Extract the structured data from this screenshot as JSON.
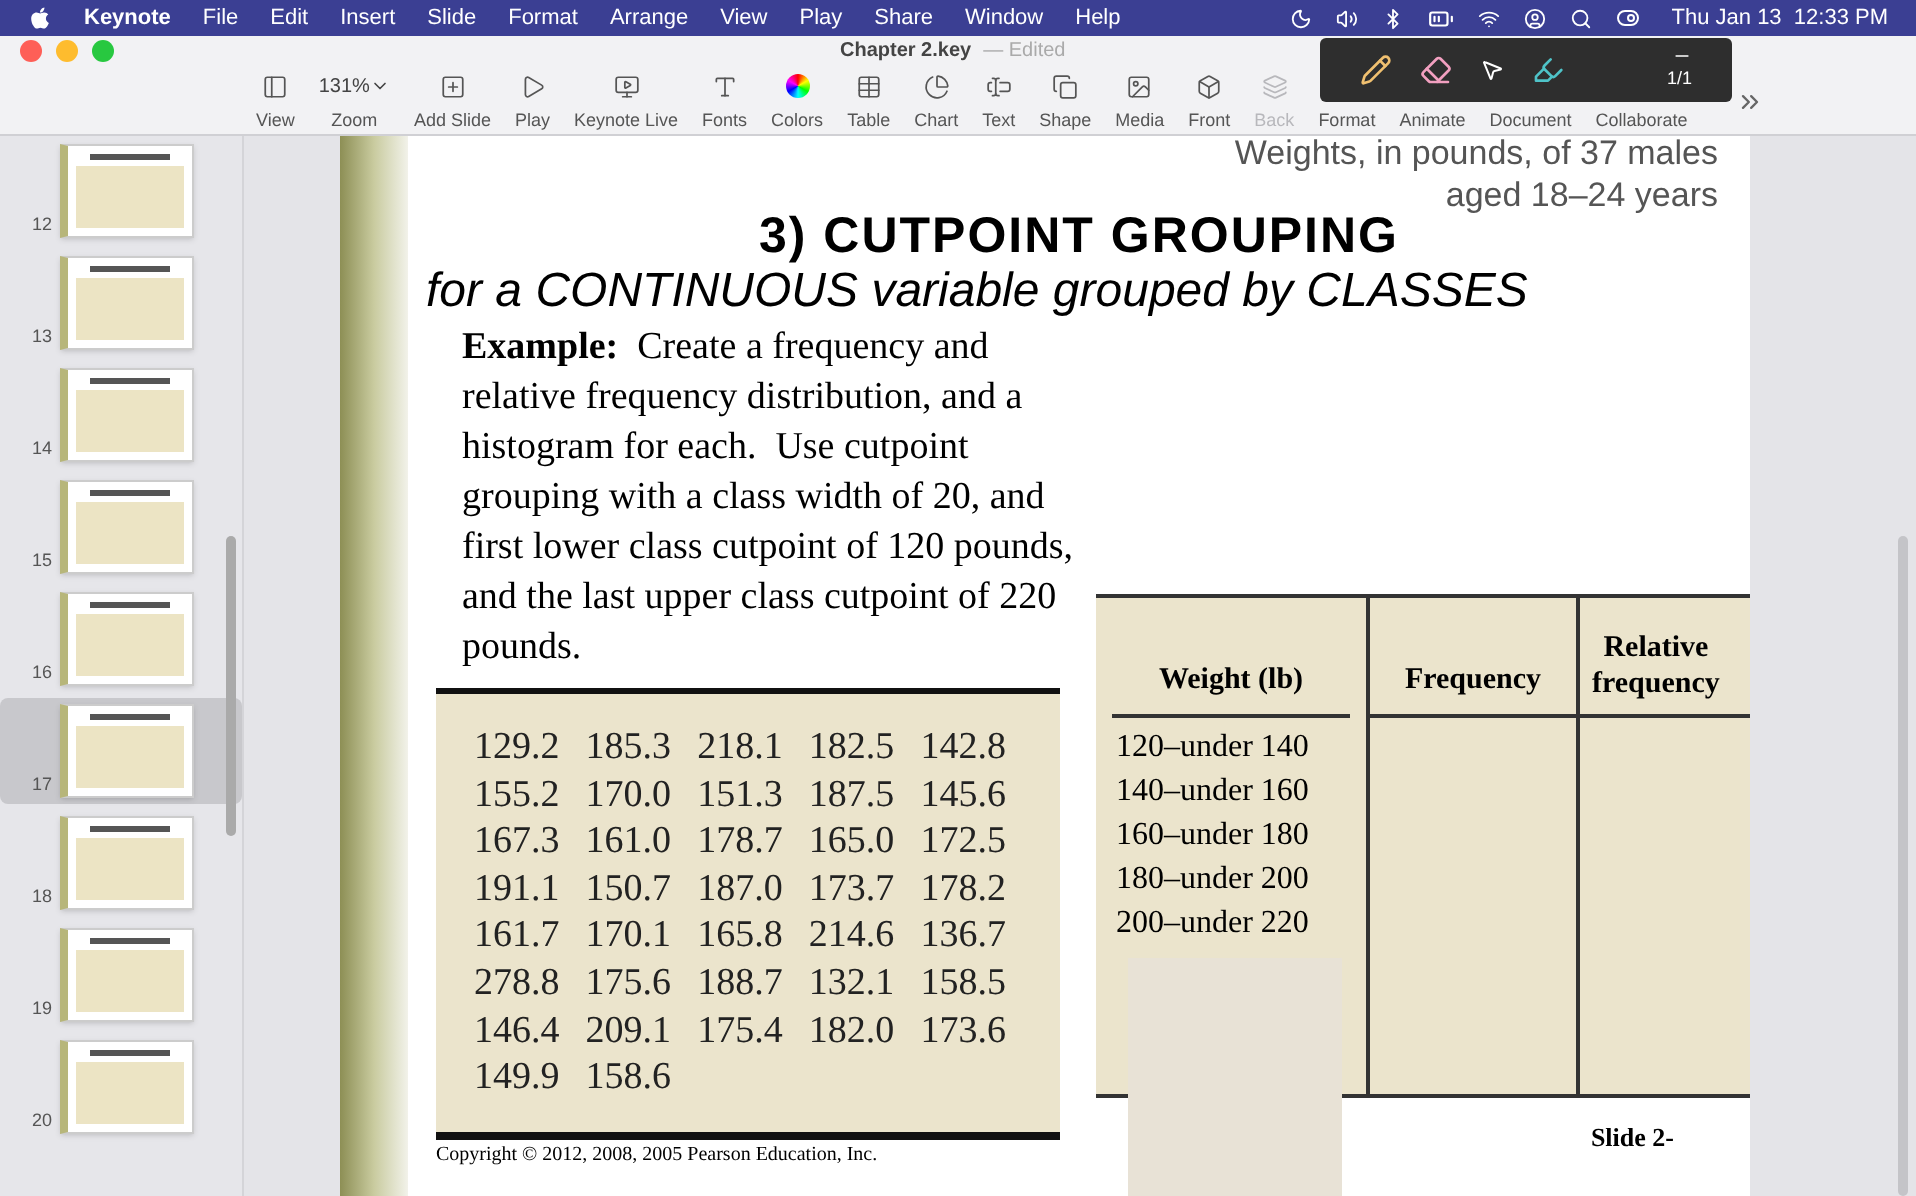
{
  "menu_bar": {
    "app": "Keynote",
    "menus": [
      "File",
      "Edit",
      "Insert",
      "Slide",
      "Format",
      "Arrange",
      "View",
      "Play",
      "Share",
      "Window",
      "Help"
    ],
    "clock": "Thu Jan 13  12:33 PM"
  },
  "window": {
    "title": "Chapter 2.key",
    "status": "— Edited"
  },
  "toolbar": [
    {
      "label": "View",
      "disabled": false
    },
    {
      "label": "Zoom",
      "disabled": false,
      "value": "131%"
    },
    {
      "label": "Add Slide",
      "disabled": false
    },
    {
      "label": "Play",
      "disabled": false
    },
    {
      "label": "Keynote Live",
      "disabled": false
    },
    {
      "label": "Fonts",
      "disabled": false
    },
    {
      "label": "Colors",
      "disabled": false
    },
    {
      "label": "Table",
      "disabled": false
    },
    {
      "label": "Chart",
      "disabled": false
    },
    {
      "label": "Text",
      "disabled": false
    },
    {
      "label": "Shape",
      "disabled": false
    },
    {
      "label": "Media",
      "disabled": false
    },
    {
      "label": "Front",
      "disabled": false
    },
    {
      "label": "Back",
      "disabled": true
    },
    {
      "label": "Format",
      "disabled": false
    },
    {
      "label": "Animate",
      "disabled": false
    },
    {
      "label": "Document",
      "disabled": false
    },
    {
      "label": "Collaborate",
      "disabled": false
    }
  ],
  "pen_toolbar": {
    "page": "1/1"
  },
  "slides": [
    {
      "number": "12",
      "selected": false
    },
    {
      "number": "13",
      "selected": false
    },
    {
      "number": "14",
      "selected": false
    },
    {
      "number": "15",
      "selected": false
    },
    {
      "number": "16",
      "selected": false
    },
    {
      "number": "17",
      "selected": true
    },
    {
      "number": "18",
      "selected": false
    },
    {
      "number": "19",
      "selected": false
    },
    {
      "number": "20",
      "selected": false
    }
  ],
  "slide": {
    "caption": [
      "Weights, in pounds, of 37 males",
      "aged 18–24 years"
    ],
    "title": "3)  CUTPOINT GROUPING",
    "subtitle": "for a CONTINUOUS variable grouped by CLASSES",
    "example": "**Example:**  Create a frequency and relative frequency distribution, and a histogram for each.  Use cutpoint grouping with a class width of 20, and first lower class cutpoint of 120 pounds, and the last upper class cutpoint of 220 pounds.",
    "data_rows": [
      [
        "129.2",
        "185.3",
        "218.1",
        "182.5",
        "142.8"
      ],
      [
        "155.2",
        "170.0",
        "151.3",
        "187.5",
        "145.6"
      ],
      [
        "167.3",
        "161.0",
        "178.7",
        "165.0",
        "172.5"
      ],
      [
        "191.1",
        "150.7",
        "187.0",
        "173.7",
        "178.2"
      ],
      [
        "161.7",
        "170.1",
        "165.8",
        "214.6",
        "136.7"
      ],
      [
        "278.8",
        "175.6",
        "188.7",
        "132.1",
        "158.5"
      ],
      [
        "146.4",
        "209.1",
        "175.4",
        "182.0",
        "173.6"
      ],
      [
        "149.9",
        "158.6"
      ]
    ],
    "table": {
      "columns": [
        "Weight (lb)",
        "Frequency",
        "Relative frequency"
      ],
      "rows": [
        "120–under 140",
        "140–under 160",
        "160–under 180",
        "180–under 200",
        "200–under 220"
      ]
    },
    "copyright": "Copyright © 2012, 2008, 2005 Pearson Education, Inc.",
    "footer": "Slide 2-"
  }
}
